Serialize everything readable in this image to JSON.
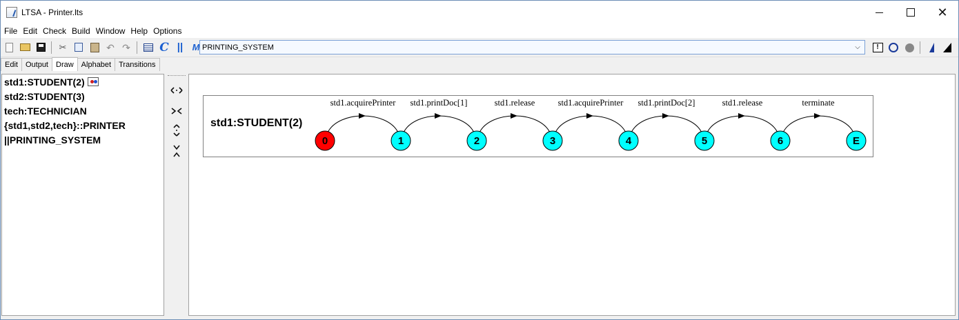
{
  "window": {
    "title": "LTSA - Printer.lts"
  },
  "menu": [
    "File",
    "Edit",
    "Check",
    "Build",
    "Window",
    "Help",
    "Options"
  ],
  "toolbar": {
    "buttons": [
      "new-file-icon",
      "open-folder-icon",
      "save-icon",
      "cut-icon",
      "copy-icon",
      "paste-icon",
      "undo-icon",
      "redo-icon",
      "list-icon",
      "compile-icon",
      "compose-icon",
      "minimise-icon"
    ],
    "target": "PRINTING_SYSTEM",
    "right_buttons": [
      "safety-check-icon",
      "run-icon",
      "stop-icon",
      "blue-arrow-icon",
      "black-arrow-icon"
    ]
  },
  "tabs": [
    {
      "label": "Edit",
      "active": false
    },
    {
      "label": "Output",
      "active": false
    },
    {
      "label": "Draw",
      "active": true
    },
    {
      "label": "Alphabet",
      "active": false
    },
    {
      "label": "Transitions",
      "active": false
    }
  ],
  "processes": [
    {
      "label": "std1:STUDENT(2)",
      "shown": true
    },
    {
      "label": "std2:STUDENT(3)",
      "shown": false
    },
    {
      "label": "tech:TECHNICIAN",
      "shown": false
    },
    {
      "label": "{std1,std2,tech}::PRINTER",
      "shown": false
    },
    {
      "label": "||PRINTING_SYSTEM",
      "shown": false
    }
  ],
  "lts": {
    "name": "std1:STUDENT(2)",
    "states": [
      "0",
      "1",
      "2",
      "3",
      "4",
      "5",
      "6",
      "E"
    ],
    "initial_state": "0",
    "transitions": [
      {
        "from": "0",
        "to": "1",
        "label": "std1.acquirePrinter"
      },
      {
        "from": "1",
        "to": "2",
        "label": "std1.printDoc[1]"
      },
      {
        "from": "2",
        "to": "3",
        "label": "std1.release"
      },
      {
        "from": "3",
        "to": "4",
        "label": "std1.acquirePrinter"
      },
      {
        "from": "4",
        "to": "5",
        "label": "std1.printDoc[2]"
      },
      {
        "from": "5",
        "to": "6",
        "label": "std1.release"
      },
      {
        "from": "6",
        "to": "E",
        "label": "terminate"
      }
    ],
    "colors": {
      "initial": "#ff0000",
      "state": "#00ffff",
      "edge": "#000000"
    }
  }
}
